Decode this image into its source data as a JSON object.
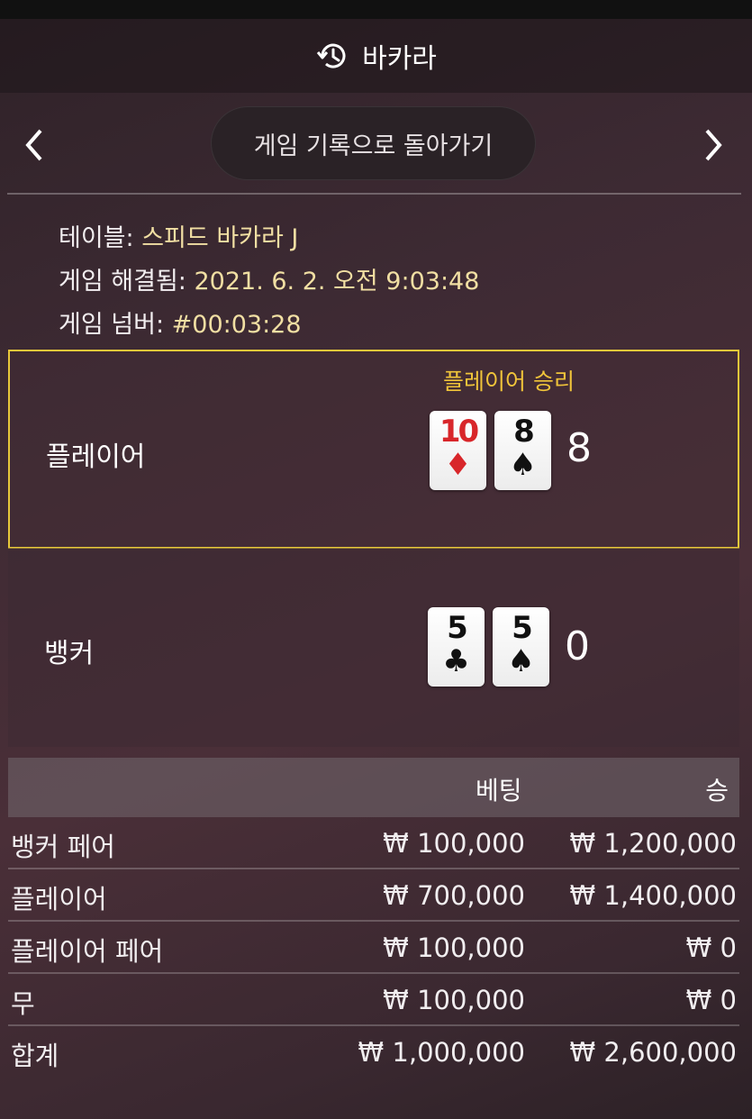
{
  "header": {
    "title": "바카라",
    "icon": "history-icon"
  },
  "nav": {
    "back_label": "게임 기록으로 돌아가기",
    "prev_icon": "chevron-left-icon",
    "next_icon": "chevron-right-icon"
  },
  "info": {
    "table_key": "테이블:",
    "table_value": "스피드 바카라 J",
    "resolved_key": "게임 해결됨:",
    "resolved_value": "2021. 6. 2. 오전 9:03:48",
    "number_key": "게임 넘버:",
    "number_value": "#00:03:28"
  },
  "player": {
    "name": "플레이어",
    "result": "플레이어 승리",
    "cards": [
      {
        "rank": "10",
        "suit": "♦",
        "color": "#d8262a"
      },
      {
        "rank": "8",
        "suit": "♠",
        "color": "#111111"
      }
    ],
    "score": "8",
    "highlight_color": "#e8c83a"
  },
  "banker": {
    "name": "뱅커",
    "cards": [
      {
        "rank": "5",
        "suit": "♣",
        "color": "#111111"
      },
      {
        "rank": "5",
        "suit": "♠",
        "color": "#111111"
      }
    ],
    "score": "0"
  },
  "bets": {
    "headers": {
      "bet": "베팅",
      "win": "승"
    },
    "rows": [
      {
        "label": "뱅커 페어",
        "bet": "₩ 100,000",
        "win": "₩ 1,200,000"
      },
      {
        "label": "플레이어",
        "bet": "₩ 700,000",
        "win": "₩ 1,400,000"
      },
      {
        "label": "플레이어 페어",
        "bet": "₩ 100,000",
        "win": "₩ 0"
      },
      {
        "label": "무",
        "bet": "₩ 100,000",
        "win": "₩ 0"
      },
      {
        "label": "합계",
        "bet": "₩ 1,000,000",
        "win": "₩ 2,600,000"
      }
    ]
  }
}
